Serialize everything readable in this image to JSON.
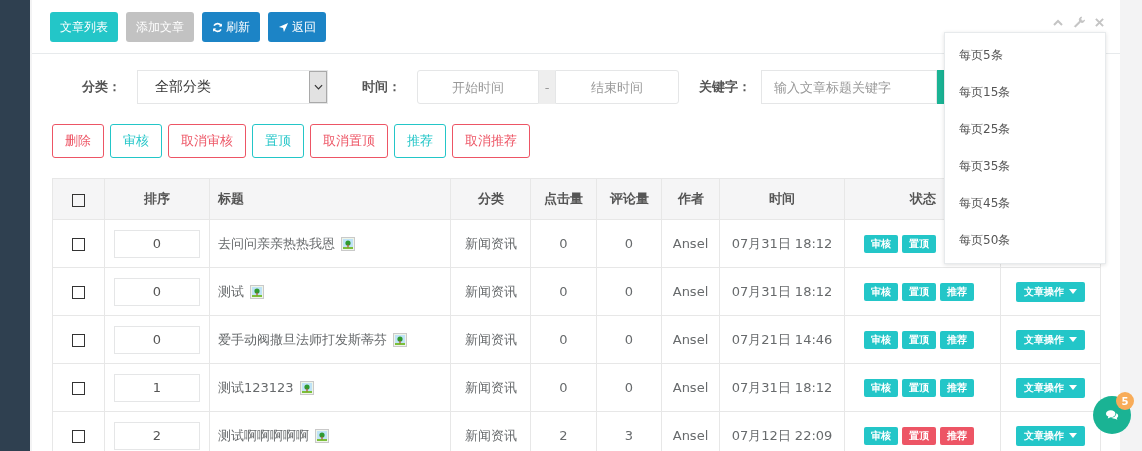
{
  "toolbar": [
    {
      "label": "文章列表",
      "kind": "primary"
    },
    {
      "label": "添加文章",
      "kind": "muted"
    },
    {
      "label": "刷新",
      "kind": "refresh"
    },
    {
      "label": "返回",
      "kind": "back"
    }
  ],
  "filters": {
    "category_label": "分类：",
    "category_value": "全部分类",
    "time_label": "时间：",
    "start_placeholder": "开始时间",
    "separator": "-",
    "end_placeholder": "结束时间",
    "keyword_label": "关键字：",
    "keyword_placeholder": "输入文章标题关键字"
  },
  "actions": [
    {
      "label": "删除",
      "kind": "danger"
    },
    {
      "label": "审核",
      "kind": "teal"
    },
    {
      "label": "取消审核",
      "kind": "danger"
    },
    {
      "label": "置顶",
      "kind": "teal"
    },
    {
      "label": "取消置顶",
      "kind": "danger"
    },
    {
      "label": "推荐",
      "kind": "teal"
    },
    {
      "label": "取消推荐",
      "kind": "danger"
    }
  ],
  "table": {
    "all_checked": false,
    "columns": [
      "排序",
      "标题",
      "分类",
      "点击量",
      "评论量",
      "作者",
      "时间",
      "状态"
    ],
    "rows": [
      {
        "checked": false,
        "order": "0",
        "title": "去问问亲亲热热我恩",
        "category": "新闻资讯",
        "clicks": "0",
        "comments": "0",
        "author": "Ansel",
        "time": "07月31日 18:12",
        "tags": [
          {
            "label": "审核",
            "on": true
          },
          {
            "label": "置顶",
            "on": true
          }
        ]
      },
      {
        "checked": false,
        "order": "0",
        "title": "测试",
        "category": "新闻资讯",
        "clicks": "0",
        "comments": "0",
        "author": "Ansel",
        "time": "07月31日 18:12",
        "tags": [
          {
            "label": "审核",
            "on": true
          },
          {
            "label": "置顶",
            "on": true
          },
          {
            "label": "推荐",
            "on": true
          }
        ],
        "action": "文章操作"
      },
      {
        "checked": false,
        "order": "0",
        "title": "爱手动阀撒旦法师打发斯蒂芬",
        "category": "新闻资讯",
        "clicks": "0",
        "comments": "0",
        "author": "Ansel",
        "time": "07月21日 14:46",
        "tags": [
          {
            "label": "审核",
            "on": true
          },
          {
            "label": "置顶",
            "on": true
          },
          {
            "label": "推荐",
            "on": true
          }
        ],
        "action": "文章操作"
      },
      {
        "checked": false,
        "order": "1",
        "title": "测试123123",
        "category": "新闻资讯",
        "clicks": "0",
        "comments": "0",
        "author": "Ansel",
        "time": "07月31日 18:12",
        "tags": [
          {
            "label": "审核",
            "on": true
          },
          {
            "label": "置顶",
            "on": true
          },
          {
            "label": "推荐",
            "on": true
          }
        ],
        "action": "文章操作"
      },
      {
        "checked": false,
        "order": "2",
        "title": "测试啊啊啊啊啊",
        "category": "新闻资讯",
        "clicks": "2",
        "comments": "3",
        "author": "Ansel",
        "time": "07月12日 22:09",
        "tags": [
          {
            "label": "审核",
            "on": true
          },
          {
            "label": "置顶",
            "on": false
          },
          {
            "label": "推荐",
            "on": false
          }
        ],
        "action": "文章操作"
      }
    ]
  },
  "page_size_menu": [
    "每页5条",
    "每页15条",
    "每页25条",
    "每页35条",
    "每页45条",
    "每页50条"
  ],
  "chat": {
    "badge": "5"
  }
}
